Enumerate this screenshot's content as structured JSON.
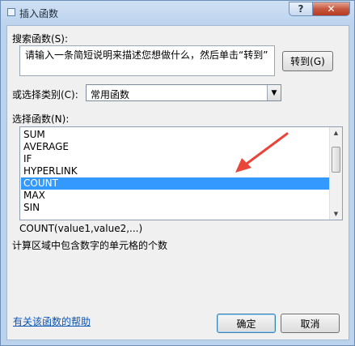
{
  "window": {
    "title": "插入函数"
  },
  "titlebar": {
    "help_label": "?",
    "close_label": "✕"
  },
  "search": {
    "label": "搜索函数(S):",
    "value": "请输入一条简短说明来描述您想做什么，然后单击“转到”",
    "goto_label": "转到(G)"
  },
  "category": {
    "label": "或选择类别(C):",
    "selected": "常用函数"
  },
  "functions": {
    "label": "选择函数(N):",
    "items": [
      "SUM",
      "AVERAGE",
      "IF",
      "HYPERLINK",
      "COUNT",
      "MAX",
      "SIN"
    ],
    "selected_index": 4
  },
  "description": {
    "signature": "COUNT(value1,value2,...)",
    "text": "计算区域中包含数字的单元格的个数"
  },
  "footer": {
    "help_link": "有关该函数的帮助",
    "ok_label": "确定",
    "cancel_label": "取消"
  },
  "colors": {
    "selection": "#3399ff",
    "annotation_arrow": "#e8463a"
  }
}
